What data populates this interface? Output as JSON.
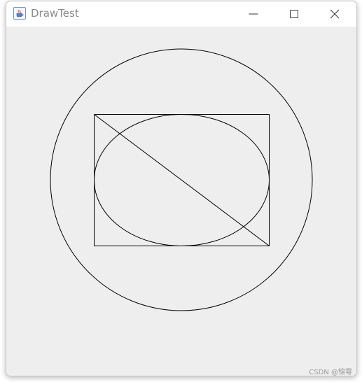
{
  "window": {
    "title": "DrawTest",
    "app_icon": "java-coffee-cup-icon",
    "controls": {
      "minimize_icon": "minimize-icon",
      "maximize_icon": "maximize-icon",
      "close_icon": "close-icon"
    }
  },
  "canvas": {
    "background": "#eeeeee",
    "stroke_color": "#000000",
    "shapes": [
      "circle",
      "rectangle",
      "ellipse",
      "diagonal-line"
    ]
  },
  "watermark": "CSDN @锦雩"
}
